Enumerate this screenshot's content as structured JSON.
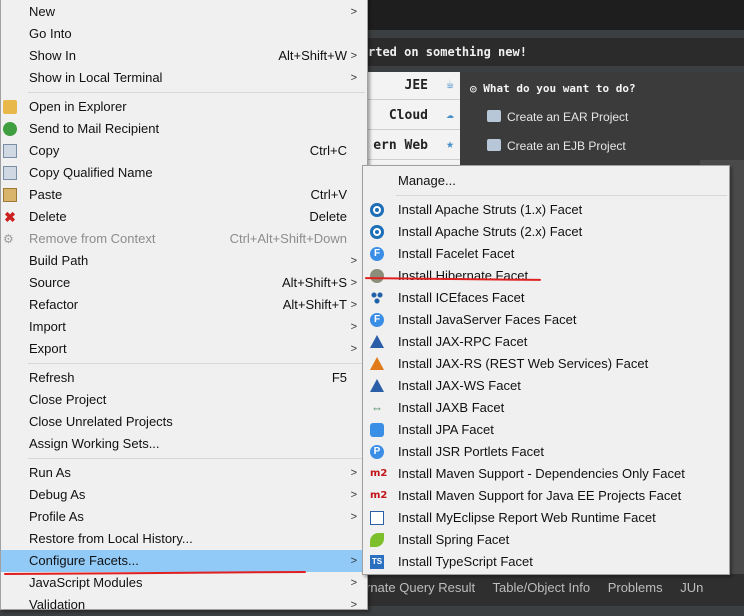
{
  "background": {
    "banner_text": "rted on something new!",
    "side_items": [
      "JEE",
      "Cloud",
      "ern Web"
    ],
    "question": "What do you want to do?",
    "links": [
      "Create an EAR Project",
      "Create an EJB Project"
    ],
    "bottom_tabs": [
      "rnate Query Result",
      "Table/Object Info",
      "Problems",
      "JUn"
    ]
  },
  "menu": {
    "items": [
      {
        "label": "New",
        "accel": "",
        "submenu": true
      },
      {
        "label": "Go Into",
        "accel": "",
        "submenu": false
      },
      {
        "label": "Show In",
        "accel": "Alt+Shift+W",
        "submenu": true
      },
      {
        "label": "Show in Local Terminal",
        "accel": "",
        "submenu": true
      },
      {
        "label": "Open in Explorer",
        "accel": "",
        "submenu": false
      },
      {
        "label": "Send to Mail Recipient",
        "accel": "",
        "submenu": false
      },
      {
        "label": "Copy",
        "accel": "Ctrl+C",
        "submenu": false
      },
      {
        "label": "Copy Qualified Name",
        "accel": "",
        "submenu": false
      },
      {
        "label": "Paste",
        "accel": "Ctrl+V",
        "submenu": false
      },
      {
        "label": "Delete",
        "accel": "Delete",
        "submenu": false
      },
      {
        "label": "Remove from Context",
        "accel": "Ctrl+Alt+Shift+Down",
        "submenu": false
      },
      {
        "label": "Build Path",
        "accel": "",
        "submenu": true
      },
      {
        "label": "Source",
        "accel": "Alt+Shift+S",
        "submenu": true
      },
      {
        "label": "Refactor",
        "accel": "Alt+Shift+T",
        "submenu": true
      },
      {
        "label": "Import",
        "accel": "",
        "submenu": true
      },
      {
        "label": "Export",
        "accel": "",
        "submenu": true
      },
      {
        "label": "Refresh",
        "accel": "F5",
        "submenu": false
      },
      {
        "label": "Close Project",
        "accel": "",
        "submenu": false
      },
      {
        "label": "Close Unrelated Projects",
        "accel": "",
        "submenu": false
      },
      {
        "label": "Assign Working Sets...",
        "accel": "",
        "submenu": false
      },
      {
        "label": "Run As",
        "accel": "",
        "submenu": true
      },
      {
        "label": "Debug As",
        "accel": "",
        "submenu": true
      },
      {
        "label": "Profile As",
        "accel": "",
        "submenu": true
      },
      {
        "label": "Restore from Local History...",
        "accel": "",
        "submenu": false
      },
      {
        "label": "Configure Facets...",
        "accel": "",
        "submenu": true
      },
      {
        "label": "JavaScript Modules",
        "accel": "",
        "submenu": true
      },
      {
        "label": "Validation",
        "accel": "",
        "submenu": true
      }
    ]
  },
  "submenu": {
    "items": [
      {
        "label": "Manage..."
      },
      {
        "label": "Install Apache Struts (1.x) Facet"
      },
      {
        "label": "Install Apache Struts (2.x) Facet"
      },
      {
        "label": "Install Facelet Facet"
      },
      {
        "label": "Install Hibernate Facet"
      },
      {
        "label": "Install ICEfaces Facet"
      },
      {
        "label": "Install JavaServer Faces Facet"
      },
      {
        "label": "Install JAX-RPC Facet"
      },
      {
        "label": "Install JAX-RS (REST Web Services) Facet"
      },
      {
        "label": "Install JAX-WS Facet"
      },
      {
        "label": "Install JAXB Facet"
      },
      {
        "label": "Install JPA Facet"
      },
      {
        "label": "Install JSR Portlets Facet"
      },
      {
        "label": "Install Maven Support - Dependencies Only Facet"
      },
      {
        "label": "Install Maven Support for Java EE Projects Facet"
      },
      {
        "label": "Install MyEclipse Report Web Runtime Facet"
      },
      {
        "label": "Install Spring Facet"
      },
      {
        "label": "Install TypeScript Facet"
      }
    ]
  },
  "icon_text": {
    "f": "F",
    "p": "P",
    "m2": "m2",
    "ts": "TS",
    "jaxb": "⇔"
  },
  "colors": {
    "highlight": "#91c9f7",
    "annotation": "#e02020",
    "menu_bg": "#f0f0f0"
  }
}
